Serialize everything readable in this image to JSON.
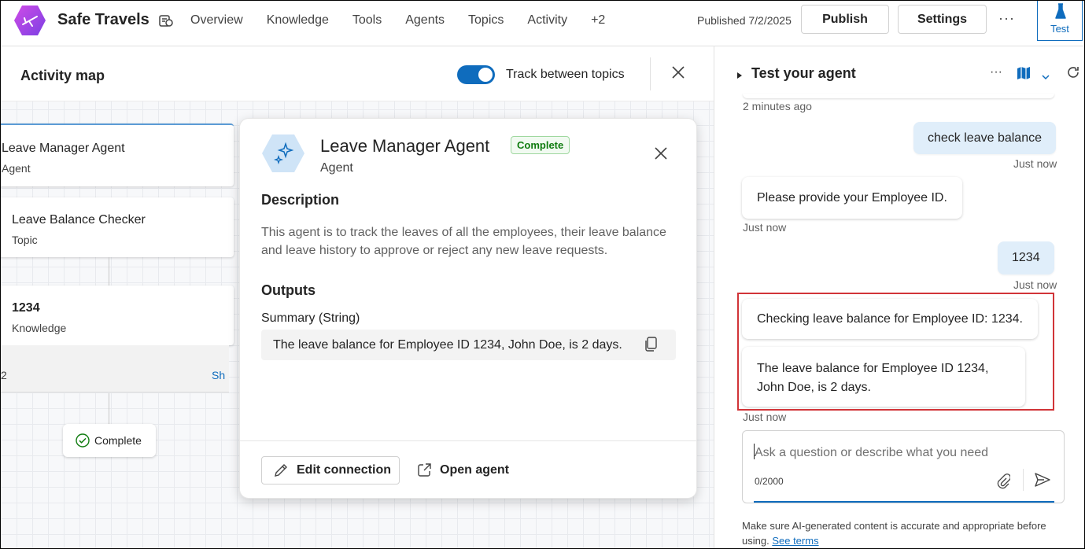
{
  "app": {
    "title": "Safe Travels",
    "nav": [
      "Overview",
      "Knowledge",
      "Tools",
      "Agents",
      "Topics",
      "Activity",
      "+2"
    ],
    "published": "Published 7/2/2025",
    "publish_label": "Publish",
    "settings_label": "Settings",
    "more": "···",
    "test_label": "Test"
  },
  "activity": {
    "title": "Activity map",
    "toggle_label": "Track between topics",
    "toggle_on": true,
    "cards": [
      {
        "title": "Leave Manager Agent",
        "sub": "Agent"
      },
      {
        "title": "Leave Balance Checker",
        "sub": "Topic"
      },
      {
        "title": "1234",
        "sub": "Knowledge"
      }
    ],
    "partial_left": "2",
    "show_link": "Sh",
    "complete_label": "Complete"
  },
  "detail": {
    "name": "Leave Manager Agent",
    "badge": "Complete",
    "kind": "Agent",
    "description_title": "Description",
    "description": "This agent is to track the leaves of all the employees, their leave balance and leave history to approve or reject any new leave requests.",
    "outputs_title": "Outputs",
    "output_label": "Summary (String)",
    "output_value": "The leave balance for Employee ID 1234, John Doe, is 2 days.",
    "edit_label": "Edit connection",
    "open_label": "Open agent"
  },
  "test": {
    "title": "Test your agent",
    "messages": {
      "ts_top": "2 minutes ago",
      "user1": "check leave balance",
      "ts_user1": "Just now",
      "bot1": "Please provide your Employee ID.",
      "ts_bot1": "Just now",
      "user2": "1234",
      "ts_user2": "Just now",
      "bot2": "Checking leave balance for Employee ID: 1234.",
      "bot3": "The leave balance for Employee ID 1234, John Doe, is 2 days.",
      "ts_bot3": "Just now"
    },
    "input_placeholder": "Ask a question or describe what you need",
    "char_count": "0/2000",
    "disclaimer": "Make sure AI-generated content is accurate and appropriate before using.",
    "see_terms": "See terms"
  },
  "colors": {
    "accent": "#0f6cbd",
    "user_bubble": "#e0eefa",
    "highlight": "#d13438",
    "complete_green": "#107c10"
  }
}
